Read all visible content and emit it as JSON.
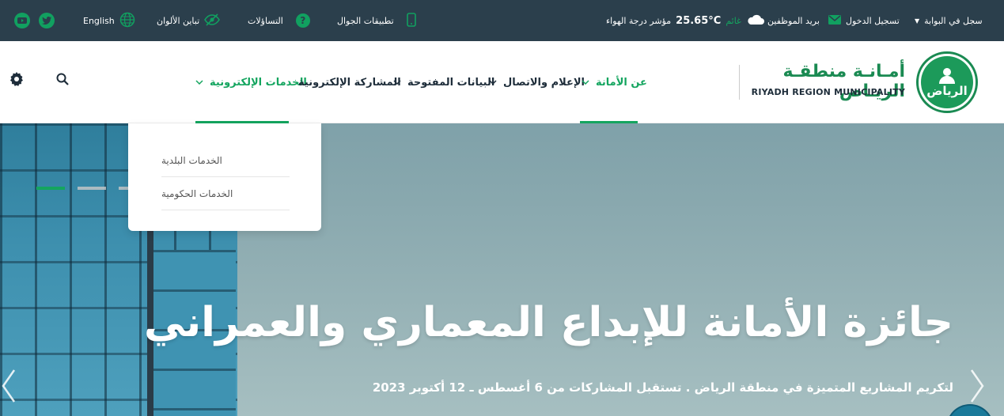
{
  "topbar": {
    "social": [
      {
        "icon": "youtube-icon"
      },
      {
        "icon": "twitter-icon"
      }
    ],
    "language_label": "English",
    "contrast_label": "تباين الألوان",
    "faq_label": "التساؤلات",
    "mobile_apps_label": "تطبيقات الجوال",
    "weather": {
      "index_label": "مؤشر درجة الهواء",
      "temperature": "25.65°C",
      "condition": "غائم"
    },
    "employee_mail_label": "بريد الموظفين",
    "login_label": "تسجيل الدخول",
    "portal_register_label": "سجل في البوابة"
  },
  "logo": {
    "arabic": "أمـانـة منطقـة الريـاض",
    "english": "RIYADH REGION MUNICIPALITY",
    "emblem_text": "الرياض"
  },
  "nav": {
    "items": [
      {
        "label": "عن الأمانة",
        "active": true,
        "has_dropdown": true
      },
      {
        "label": "الإعلام والاتصال",
        "active": false,
        "has_dropdown": true
      },
      {
        "label": "البيانات المفتوحة",
        "active": false,
        "has_dropdown": true
      },
      {
        "label": "المشاركة الإلكترونية",
        "active": false,
        "has_dropdown": false
      },
      {
        "label": "الخدمات الإلكترونية",
        "active": true,
        "has_dropdown": true
      }
    ],
    "dropdown": {
      "items": [
        "الخدمات البلدية",
        "الخدمات الحكومية"
      ]
    }
  },
  "hero": {
    "title": "جائزة الأمانة للإبداع المعماري والعمراني",
    "subtitle": "لتكريم المشاريع المتميزة في منطقة الرياض . تستقبل المشاركات من 6 أغسطس ـ 12 أكتوبر 2023"
  },
  "colors": {
    "topbar_bg": "#2b3f4c",
    "accent_green": "#14a55f",
    "nav_text": "#1e2d3a"
  }
}
